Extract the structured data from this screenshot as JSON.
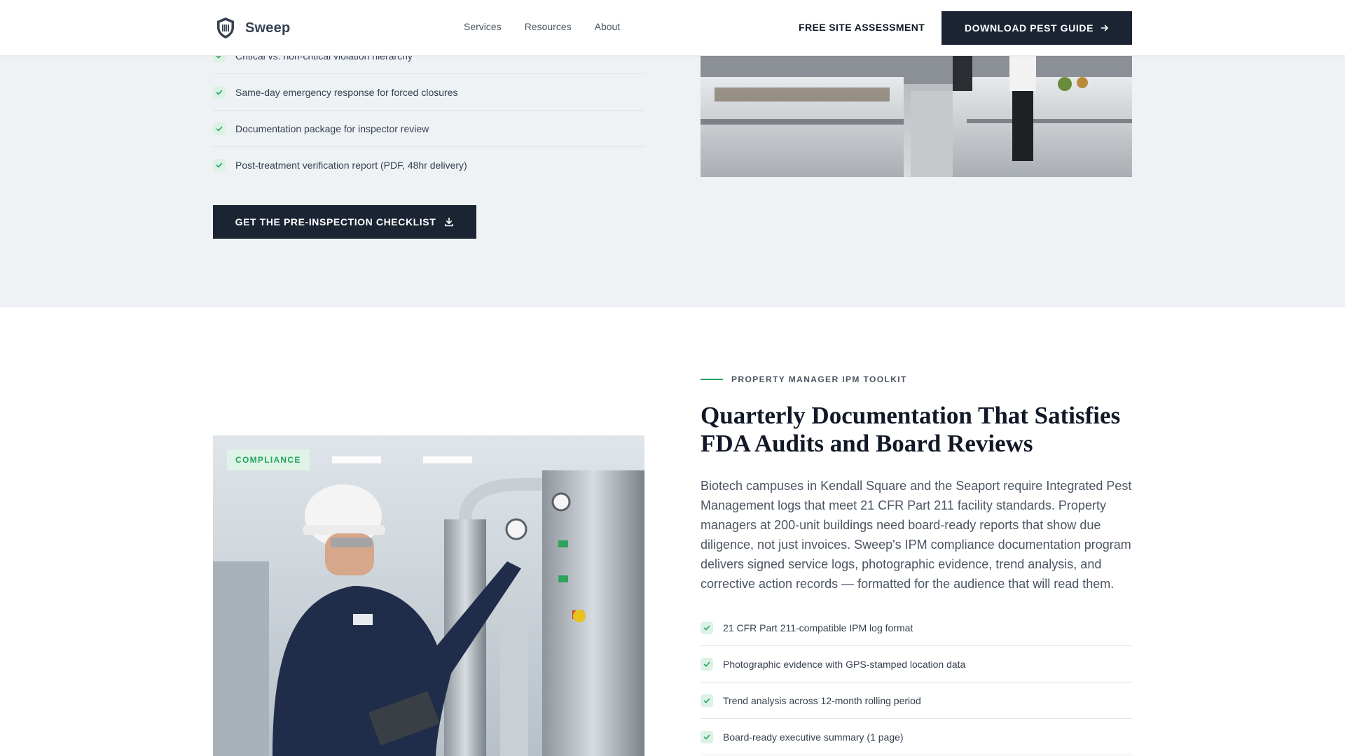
{
  "header": {
    "brand": "Sweep",
    "nav": [
      "Services",
      "Resources",
      "About"
    ],
    "cta_text": "FREE SITE ASSESSMENT",
    "cta_button": "DOWNLOAD PEST GUIDE"
  },
  "upper": {
    "checklist": [
      "Critical vs. non-critical violation hierarchy",
      "Same-day emergency response for forced closures",
      "Documentation package for inspector review",
      "Post-treatment verification report (PDF, 48hr delivery)"
    ],
    "cta": "GET THE PRE-INSPECTION CHECKLIST"
  },
  "lower": {
    "badge": "COMPLIANCE",
    "eyebrow": "PROPERTY MANAGER IPM TOOLKIT",
    "heading": "Quarterly Documentation That Satisfies FDA Audits and Board Reviews",
    "body": "Biotech campuses in Kendall Square and the Seaport require Integrated Pest Management logs that meet 21 CFR Part 211 facility standards. Property managers at 200-unit buildings need board-ready reports that show due diligence, not just invoices. Sweep's IPM compliance documentation program delivers signed service logs, photographic evidence, trend analysis, and corrective action records — formatted for the audience that will read them.",
    "checklist": [
      "21 CFR Part 211-compatible IPM log format",
      "Photographic evidence with GPS-stamped location data",
      "Trend analysis across 12-month rolling period",
      "Board-ready executive summary (1 page)"
    ]
  },
  "colors": {
    "primary_dark": "#1b2433",
    "accent_green": "#22a45d",
    "section_bg": "#eef2f5"
  },
  "icons": [
    "shield-logo-icon",
    "check-icon",
    "arrow-right-icon",
    "download-icon"
  ]
}
